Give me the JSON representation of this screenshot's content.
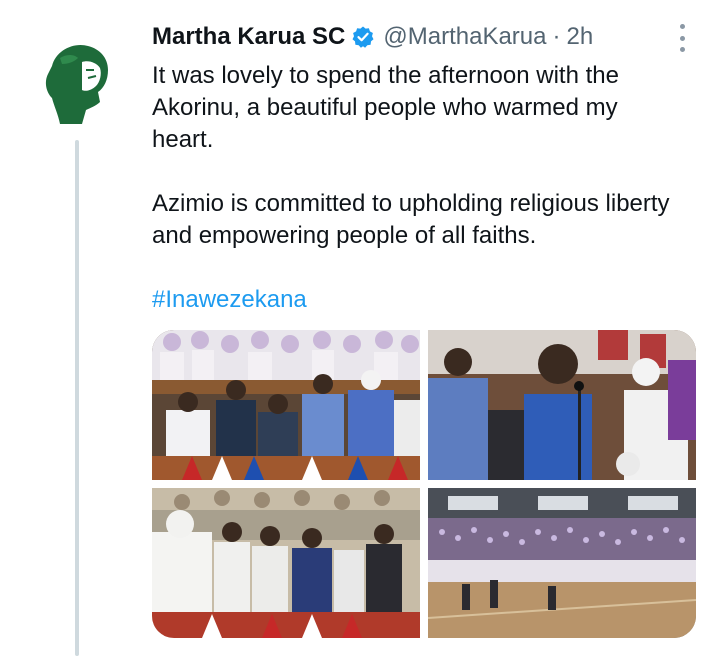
{
  "tweet": {
    "author_name": "Martha Karua SC",
    "handle": "@MarthaKarua",
    "separator": "·",
    "time": "2h",
    "paragraph_1": "It was lovely to spend the afternoon with the Akorinu, a beautiful people who warmed my heart.",
    "paragraph_2": "Azimio is committed to upholding religious liberty and empowering people of all faiths.",
    "hashtag": "#Inawezekana"
  },
  "icons": {
    "avatar": "green-silhouette-logo",
    "verified": "verified-badge-icon",
    "more": "more-options-icon"
  },
  "colors": {
    "link": "#1d9bf0",
    "verified": "#1d9bf0",
    "secondary_text": "#536471",
    "thread_line": "#cfd9de",
    "avatar_green": "#1e6b3a"
  },
  "media": [
    {
      "alt": "photo-1"
    },
    {
      "alt": "photo-2"
    },
    {
      "alt": "photo-3"
    },
    {
      "alt": "photo-4"
    }
  ]
}
